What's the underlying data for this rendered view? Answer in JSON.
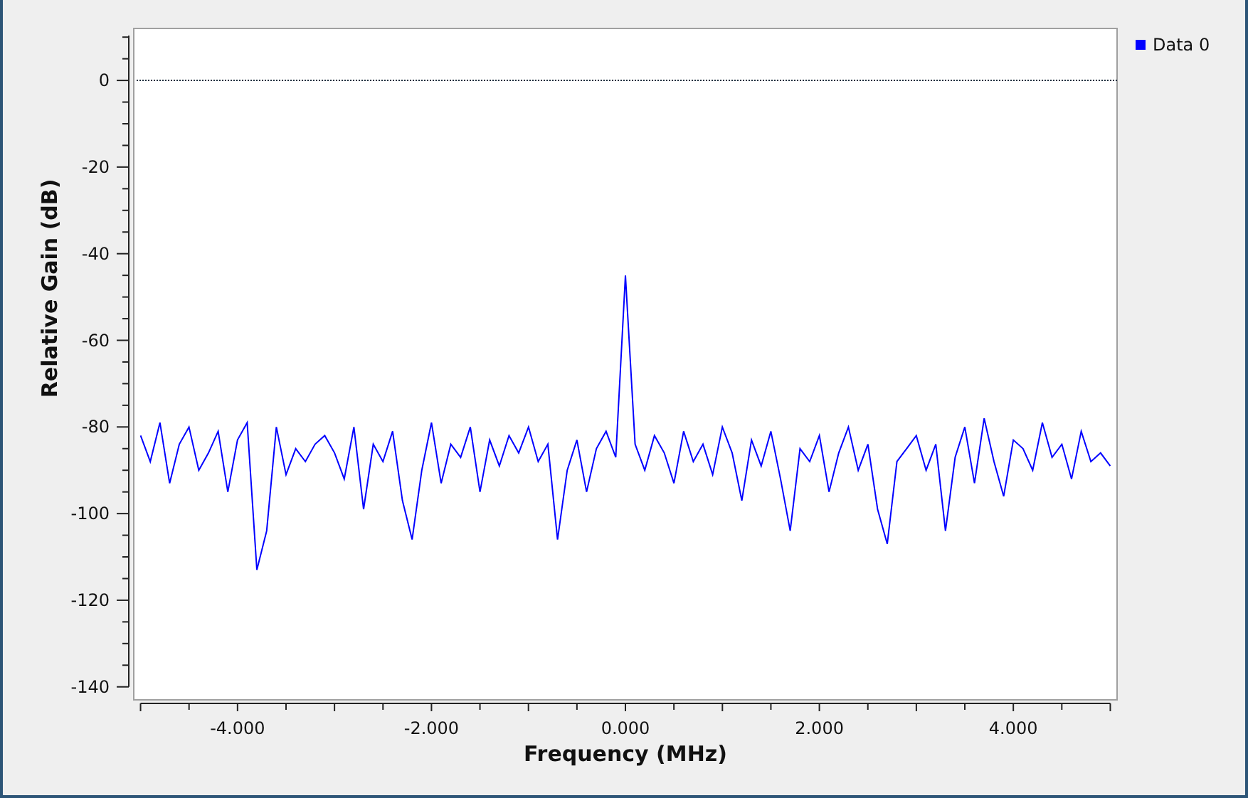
{
  "chart_data": {
    "type": "line",
    "xlabel": "Frequency (MHz)",
    "ylabel": "Relative Gain (dB)",
    "x": [
      -5,
      -4.9,
      -4.8,
      -4.7,
      -4.6,
      -4.5,
      -4.4,
      -4.3,
      -4.2,
      -4.1,
      -4,
      -3.9,
      -3.8,
      -3.7,
      -3.6,
      -3.5,
      -3.4,
      -3.3,
      -3.2,
      -3.1,
      -3,
      -2.9,
      -2.8,
      -2.7,
      -2.6,
      -2.5,
      -2.4,
      -2.3,
      -2.2,
      -2.1,
      -2,
      -1.9,
      -1.8,
      -1.7,
      -1.6,
      -1.5,
      -1.4,
      -1.3,
      -1.2,
      -1.1,
      -1,
      -0.9,
      -0.8,
      -0.7,
      -0.6,
      -0.5,
      -0.4,
      -0.3,
      -0.2,
      -0.1,
      0,
      0.1,
      0.2,
      0.3,
      0.4,
      0.5,
      0.6,
      0.7,
      0.8,
      0.9,
      1,
      1.1,
      1.2,
      1.3,
      1.4,
      1.5,
      1.6,
      1.7,
      1.8,
      1.9,
      2,
      2.1,
      2.2,
      2.3,
      2.4,
      2.5,
      2.6,
      2.7,
      2.8,
      2.9,
      3,
      3.1,
      3.2,
      3.3,
      3.4,
      3.5,
      3.6,
      3.7,
      3.8,
      3.9,
      4,
      4.1,
      4.2,
      4.3,
      4.4,
      4.5,
      4.6,
      4.7,
      4.8,
      4.9,
      5
    ],
    "series": [
      {
        "name": "Data 0",
        "color": "#0000ff",
        "values": [
          -82,
          -88,
          -79,
          -93,
          -84,
          -80,
          -90,
          -86,
          -81,
          -95,
          -83,
          -79,
          -113,
          -104,
          -80,
          -91,
          -85,
          -88,
          -84,
          -82,
          -86,
          -92,
          -80,
          -99,
          -84,
          -88,
          -81,
          -97,
          -106,
          -90,
          -79,
          -93,
          -84,
          -87,
          -80,
          -95,
          -83,
          -89,
          -82,
          -86,
          -80,
          -88,
          -84,
          -106,
          -90,
          -83,
          -95,
          -85,
          -81,
          -87,
          -45,
          -84,
          -90,
          -82,
          -86,
          -93,
          -81,
          -88,
          -84,
          -91,
          -80,
          -86,
          -97,
          -83,
          -89,
          -81,
          -92,
          -104,
          -85,
          -88,
          -82,
          -95,
          -86,
          -80,
          -90,
          -84,
          -99,
          -107,
          -88,
          -85,
          -82,
          -90,
          -84,
          -104,
          -87,
          -80,
          -93,
          -78,
          -88,
          -96,
          -83,
          -85,
          -90,
          -79,
          -87,
          -84,
          -92,
          -81,
          -88,
          -86,
          -89
        ]
      }
    ],
    "xlim": [
      -5.07,
      5.07
    ],
    "ylim": [
      -143,
      12
    ],
    "xticks": [
      {
        "value": -4,
        "label": "-4.000"
      },
      {
        "value": -2,
        "label": "-2.000"
      },
      {
        "value": 0,
        "label": "0.000"
      },
      {
        "value": 2,
        "label": "2.000"
      },
      {
        "value": 4,
        "label": "4.000"
      }
    ],
    "yticks": [
      0,
      -20,
      -40,
      -60,
      -80,
      -100,
      -120,
      -140
    ]
  }
}
